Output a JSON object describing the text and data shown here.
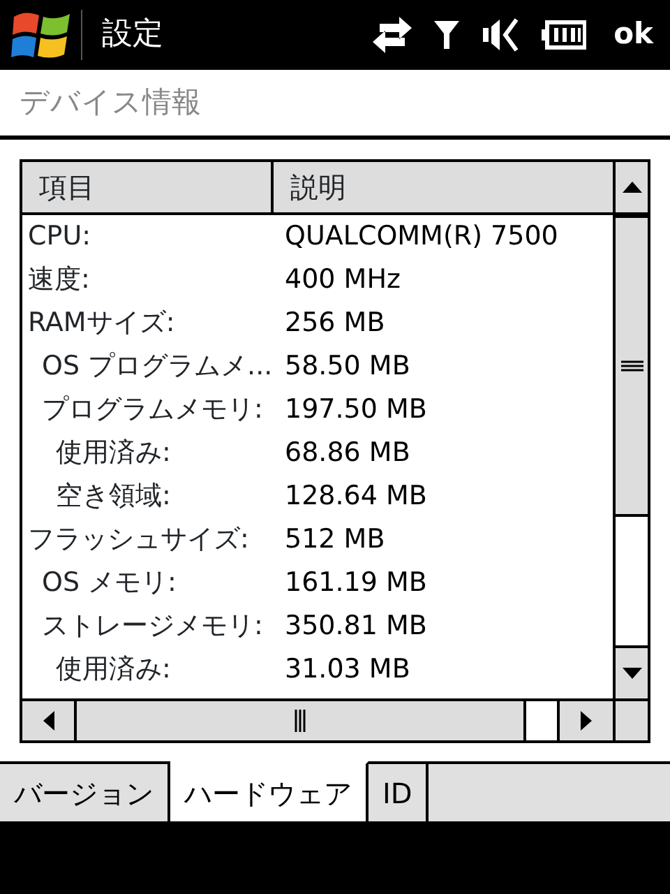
{
  "top_bar": {
    "title": "設定",
    "ok_button": "ok"
  },
  "header": {
    "title": "デバイス情報"
  },
  "list": {
    "columns": [
      "項目",
      "説明"
    ],
    "rows": [
      {
        "label": "CPU:",
        "value": "QUALCOMM(R) 7500"
      },
      {
        "label": "速度:",
        "value": "400 MHz"
      },
      {
        "label": "RAMサイズ:",
        "value": "256 MB",
        "children": [
          {
            "label": "OS プログラムメ...",
            "value": "58.50 MB"
          },
          {
            "label": "プログラムメモリ:",
            "value": "197.50 MB",
            "children": [
              {
                "label": "使用済み:",
                "value": "68.86 MB"
              },
              {
                "label": "空き領域:",
                "value": "128.64 MB"
              }
            ]
          }
        ]
      },
      {
        "label": "フラッシュサイズ:",
        "value": "512 MB",
        "children": [
          {
            "label": "OS メモリ:",
            "value": "161.19 MB"
          },
          {
            "label": "ストレージメモリ:",
            "value": "350.81 MB",
            "children": [
              {
                "label": "使用済み:",
                "value": "31.03 MB"
              }
            ]
          }
        ]
      }
    ]
  },
  "tabs": [
    {
      "label": "バージョン",
      "selected": false
    },
    {
      "label": "ハードウェア",
      "selected": true
    },
    {
      "label": "ID",
      "selected": false
    }
  ]
}
